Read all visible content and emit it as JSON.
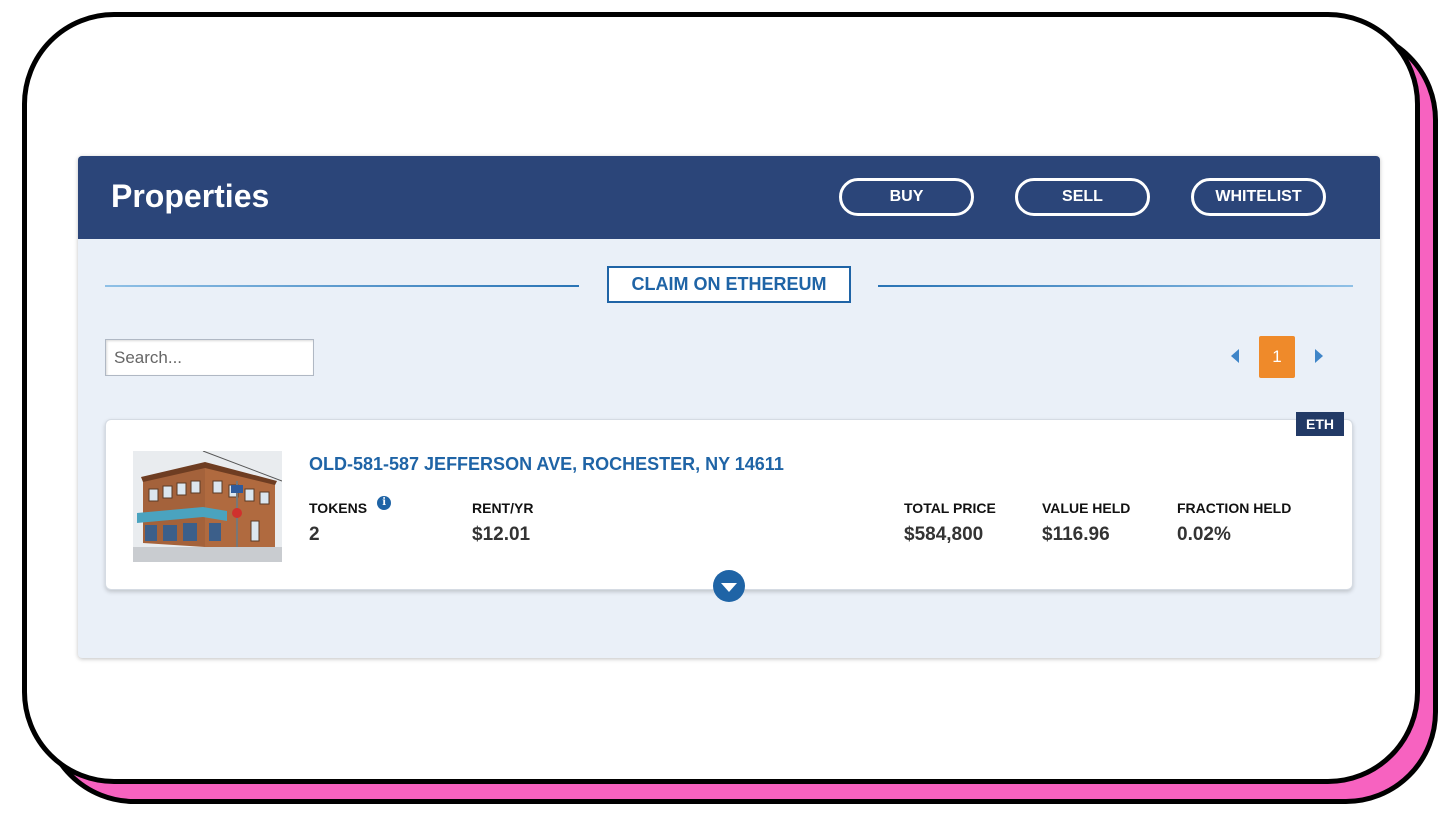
{
  "header": {
    "title": "Properties",
    "buy_label": "BUY",
    "sell_label": "SELL",
    "whitelist_label": "WHITELIST"
  },
  "claim_label": "CLAIM ON ETHEREUM",
  "search": {
    "placeholder": "Search...",
    "value": ""
  },
  "pagination": {
    "current_page": "1",
    "prev_icon": "caret-left-icon",
    "next_icon": "caret-right-icon"
  },
  "property": {
    "network_badge": "ETH",
    "title": "OLD-581-587 JEFFERSON AVE, ROCHESTER, NY 14611",
    "tokens_label": "TOKENS",
    "tokens_value": "2",
    "info_icon": "info-icon",
    "rent_label": "RENT/YR",
    "rent_value": "$12.01",
    "total_price_label": "TOTAL PRICE",
    "total_price_value": "$584,800",
    "value_held_label": "VALUE HELD",
    "value_held_value": "$116.96",
    "fraction_held_label": "FRACTION HELD",
    "fraction_held_value": "0.02%",
    "expand_icon": "chevron-down-icon"
  },
  "colors": {
    "header_bg": "#2b4579",
    "accent_blue": "#1f64a6",
    "page_active": "#ef8a2a",
    "frame_shadow": "#f762c0",
    "panel_bg": "#eaf0f8"
  }
}
